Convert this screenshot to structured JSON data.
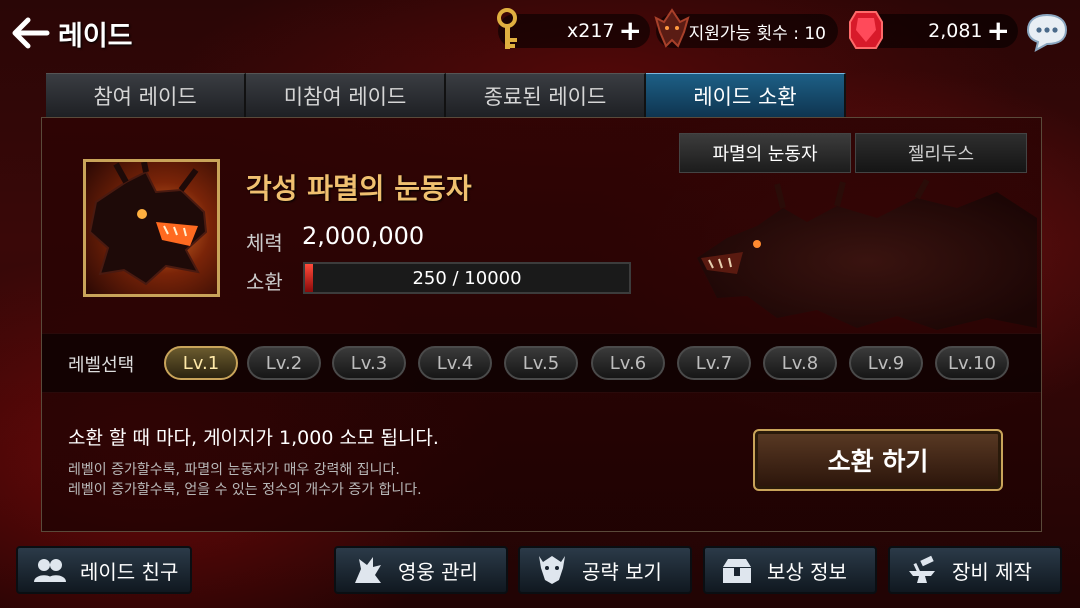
{
  "header": {
    "title": "레이드",
    "back_icon": "back-arrow-icon"
  },
  "resources": {
    "keys": "x217",
    "support_count": "지원가능 횟수 : 10",
    "gems": "2,081"
  },
  "tabs": [
    {
      "label": "참여 레이드",
      "active": false
    },
    {
      "label": "미참여 레이드",
      "active": false
    },
    {
      "label": "종료된 레이드",
      "active": false
    },
    {
      "label": "레이드 소환",
      "active": true
    }
  ],
  "boss_tabs": [
    {
      "label": "파멸의 눈동자",
      "active": true
    },
    {
      "label": "젤리두스",
      "active": false
    }
  ],
  "boss": {
    "name": "각성 파멸의 눈동자",
    "hp_label": "체력",
    "hp_value": "2,000,000",
    "summon_label": "소환",
    "summon_gauge_text": "250 / 10000",
    "summon_current": 250,
    "summon_max": 10000
  },
  "levels": {
    "label": "레벨선택",
    "items": [
      "Lv.1",
      "Lv.2",
      "Lv.3",
      "Lv.4",
      "Lv.5",
      "Lv.6",
      "Lv.7",
      "Lv.8",
      "Lv.9",
      "Lv.10"
    ],
    "selected": 0
  },
  "info": {
    "main": "소환 할 때 마다, 게이지가 1,000 소모 됩니다.",
    "line1": "레벨이 증가할수록, 파멸의 눈동자가 매우 강력해 집니다.",
    "line2": "레벨이 증가할수록, 얻을 수 있는 정수의 개수가 증가 합니다."
  },
  "summon_button": "소환 하기",
  "bottom_nav": {
    "friends": "레이드 친구",
    "heroes": "영웅 관리",
    "guide": "공략 보기",
    "reward": "보상 정보",
    "equip": "장비 제작"
  },
  "colors": {
    "accent_gold": "#c9a45a",
    "active_tab": "#1d5f86",
    "boss_name": "#f0c070",
    "gauge": "#ff4a3a"
  }
}
